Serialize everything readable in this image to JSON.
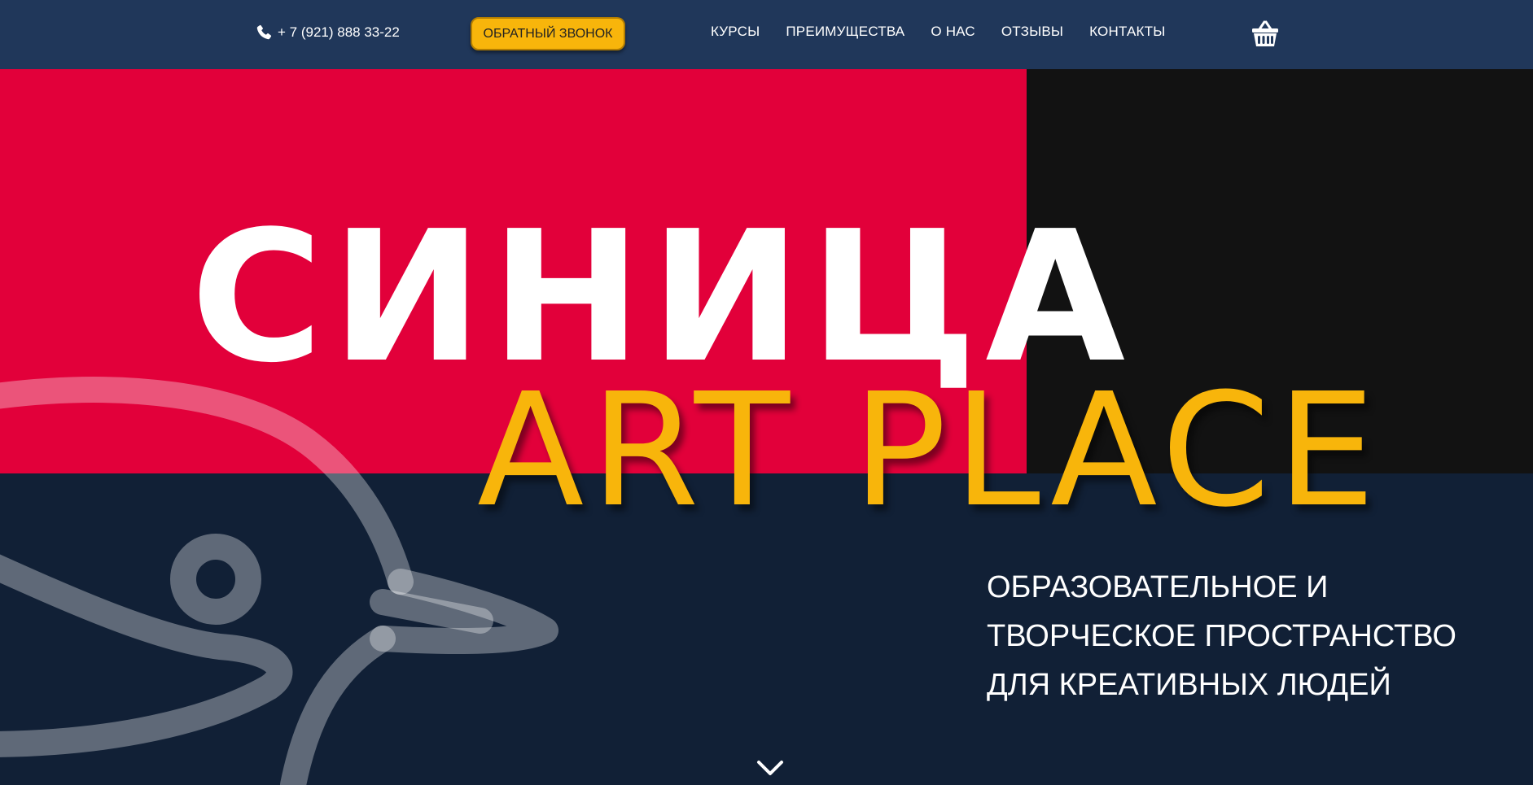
{
  "header": {
    "phone": {
      "icon": "phone-icon",
      "number": "+ 7 (921) 888 33-22"
    },
    "callback_button": "ОБРАТНЫЙ ЗВОНОК",
    "nav": [
      {
        "label": "КУРСЫ"
      },
      {
        "label": "ПРЕИМУЩЕСТВА"
      },
      {
        "label": "О НАС"
      },
      {
        "label": "ОТЗЫВЫ"
      },
      {
        "label": "КОНТАКТЫ"
      }
    ],
    "cart_icon": "basket-icon"
  },
  "hero": {
    "title": "СИНИЦА",
    "subtitle": "ART PLACE",
    "tagline": [
      "ОБРАЗОВАТЕЛЬНОЕ И",
      "ТВОРЧЕСКОЕ ПРОСТРАНСТВО",
      "ДЛЯ КРЕАТИВНЫХ ЛЮДЕЙ"
    ],
    "scroll_icon": "chevron-down-icon",
    "decoration_icon": "bird-outline-icon"
  },
  "colors": {
    "header_bg": "#20375a",
    "hero_red": "#e2003a",
    "hero_black": "#121212",
    "hero_navy": "#112036",
    "accent_yellow": "#f8b50b",
    "bird_stroke": "#5a6a7c"
  }
}
